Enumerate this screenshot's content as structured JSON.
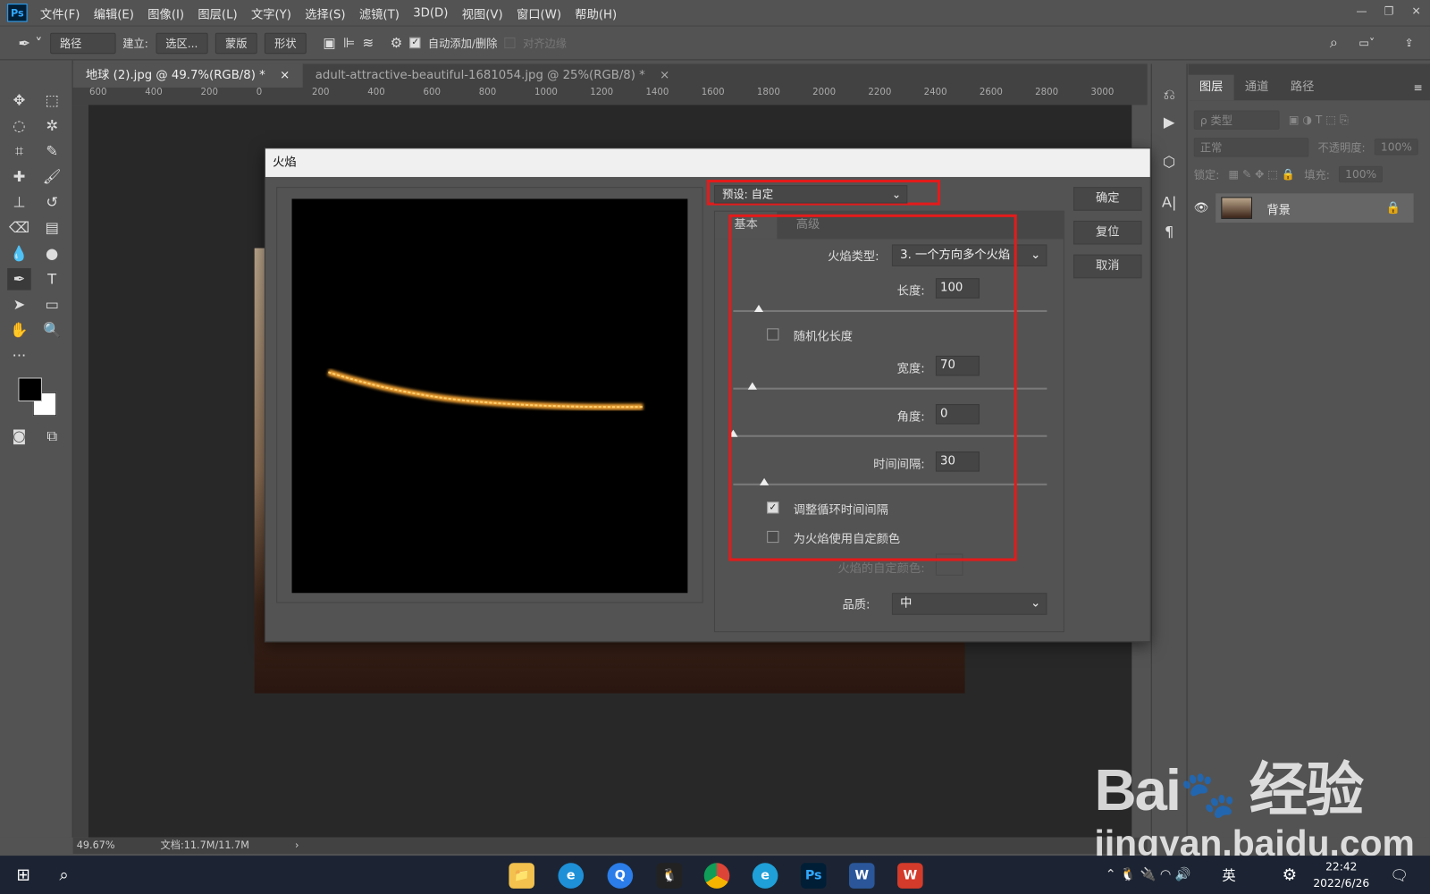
{
  "app": {
    "logo": "Ps",
    "menu": [
      "文件(F)",
      "编辑(E)",
      "图像(I)",
      "图层(L)",
      "文字(Y)",
      "选择(S)",
      "滤镜(T)",
      "3D(D)",
      "视图(V)",
      "窗口(W)",
      "帮助(H)"
    ],
    "window_controls": [
      "—",
      "❐",
      "✕"
    ]
  },
  "options": {
    "mode": "路径",
    "build_label": "建立:",
    "selection": "选区...",
    "mask": "蒙版",
    "shape": "形状",
    "auto_add": "自动添加/删除",
    "align_edges": "对齐边缘"
  },
  "tabs": [
    {
      "label": "地球 (2).jpg @ 49.7%(RGB/8) *",
      "close": "×"
    },
    {
      "label": "adult-attractive-beautiful-1681054.jpg @ 25%(RGB/8) *",
      "close": "×"
    }
  ],
  "ruler": [
    "600",
    "400",
    "200",
    "0",
    "200",
    "400",
    "600",
    "800",
    "1000",
    "1200",
    "1400",
    "1600",
    "1800",
    "2000",
    "2200",
    "2400",
    "2600",
    "2800",
    "3000"
  ],
  "status": {
    "zoom": "49.67%",
    "doc": "文档:11.7M/11.7M",
    "arrow": "›"
  },
  "layers_panel": {
    "tabs": [
      "图层",
      "通道",
      "路径"
    ],
    "filter": "ρ 类型",
    "blend": "正常",
    "opacity_label": "不透明度:",
    "opacity": "100%",
    "lock_label": "锁定:",
    "fill_label": "填充:",
    "fill": "100%",
    "layers": [
      {
        "name": "背景"
      }
    ]
  },
  "dialog": {
    "title": "火焰",
    "preset": "预设: 自定",
    "buttons": {
      "ok": "确定",
      "reset": "复位",
      "cancel": "取消"
    },
    "tabs": [
      "基本",
      "高级"
    ],
    "flame_type_label": "火焰类型:",
    "flame_type": "3. 一个方向多个火焰",
    "length_label": "长度:",
    "length": "100",
    "length_slider": 0.08,
    "randomize_label": "随机化长度",
    "randomize": false,
    "width_label": "宽度:",
    "width": "70",
    "width_slider": 0.06,
    "angle_label": "角度:",
    "angle": "0",
    "angle_slider": 0.0,
    "interval_label": "时间间隔:",
    "interval": "30",
    "interval_slider": 0.1,
    "adjust_loop_label": "调整循环时间间隔",
    "adjust_loop": true,
    "custom_color_label": "为火焰使用自定颜色",
    "custom_color": false,
    "flame_color_label": "火焰的自定颜色:",
    "quality_label": "品质:",
    "quality": "中"
  },
  "taskbar": {
    "time": "22:42",
    "date": "2022/6/26",
    "ime": "英"
  },
  "watermark": {
    "brand": "Bai du 经验",
    "url": "jingyan.baidu.com"
  }
}
